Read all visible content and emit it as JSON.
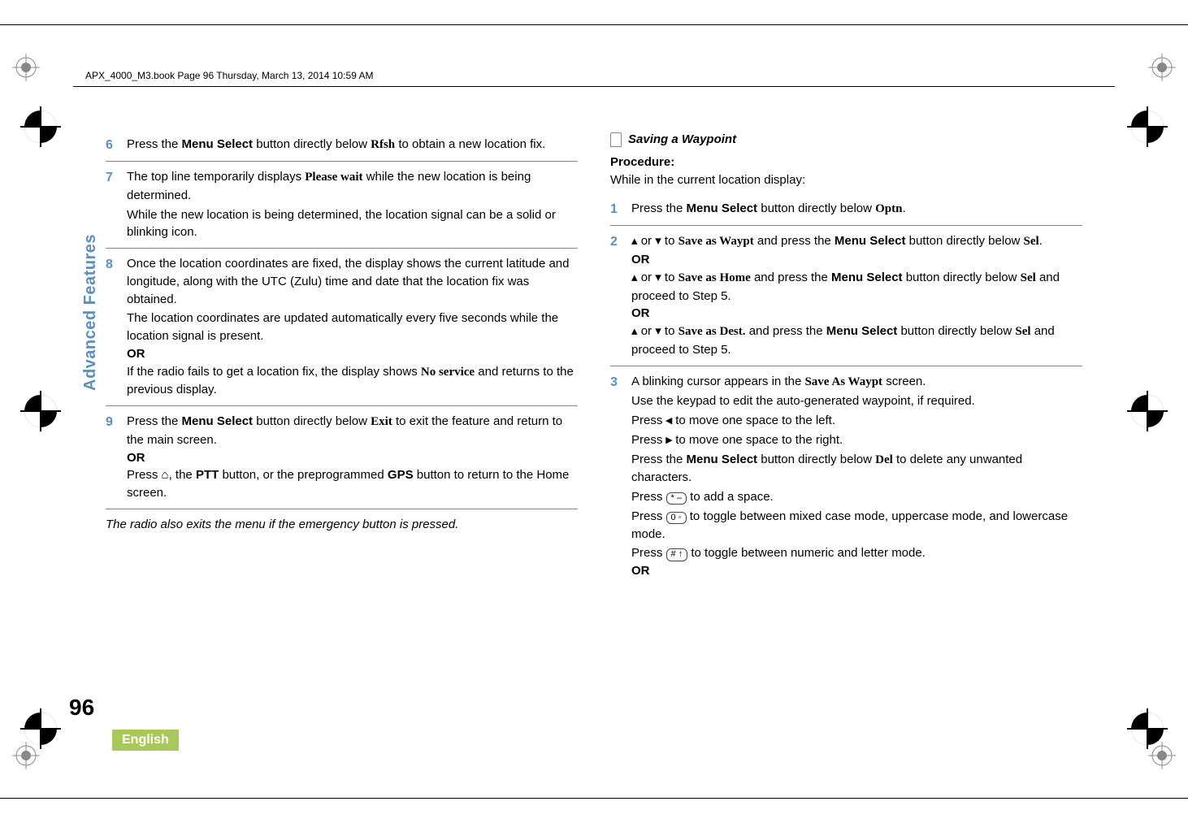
{
  "header": "APX_4000_M3.book  Page 96  Thursday, March 13, 2014  10:59 AM",
  "sidebar": "Advanced Features",
  "page_number": "96",
  "language": "English",
  "left": {
    "s6": {
      "num": "6",
      "text_a": "Press the ",
      "menu_select": "Menu Select",
      "text_b": " button directly below ",
      "rfsh": "Rfsh",
      "text_c": " to obtain a new location fix."
    },
    "s7": {
      "num": "7",
      "text_a": "The top line temporarily displays ",
      "please_wait": "Please wait",
      "text_b": " while the new location is being determined.",
      "text_c": "While the new location is being determined, the location signal can be a solid or blinking icon."
    },
    "s8": {
      "num": "8",
      "text_a": "Once the location coordinates are fixed, the display shows the current latitude and longitude, along with the UTC (Zulu) time and date that the location fix was obtained.",
      "text_b": "The location coordinates are updated automatically every five seconds while the location signal is present.",
      "or": "OR",
      "text_c": "If the radio fails to get a location fix, the display shows ",
      "no_service": "No service",
      "text_d": " and returns to the previous display."
    },
    "s9": {
      "num": "9",
      "text_a": "Press the ",
      "menu_select": "Menu Select",
      "text_b": " button directly below ",
      "exit": "Exit",
      "text_c": " to exit the feature and return to the main screen.",
      "or": "OR",
      "text_d": "Press ",
      "home": "⌂",
      "text_e": ", the ",
      "ptt": "PTT",
      "text_f": " button, or the preprogrammed ",
      "gps": "GPS",
      "text_g": " button to return to the Home screen."
    },
    "note": "The radio also exits the menu if the emergency button is pressed."
  },
  "right": {
    "section_title": "Saving a Waypoint",
    "procedure": "Procedure:",
    "procedure_desc": "While in the current location display:",
    "s1": {
      "num": "1",
      "text_a": "Press the ",
      "menu_select": "Menu Select",
      "text_b": " button directly below ",
      "optn": "Optn",
      "text_c": "."
    },
    "s2": {
      "num": "2",
      "up": "▴",
      "or_word": " or ",
      "down": "▾",
      "to": " to ",
      "save_waypt": "Save as Waypt",
      "text_a": " and press the ",
      "menu_select": "Menu Select",
      "text_b": " button directly below ",
      "sel": "Sel",
      "dot": ".",
      "or": "OR",
      "save_home": "Save as Home",
      "btn_txt": " and press the ",
      "menu_select2": "Menu Select",
      "btn_txt2": " button directly below ",
      "sel2": "Sel",
      "proceed": " and proceed to Step 5.",
      "save_dest": "Save as Dest.",
      "menu_select3": "Menu Select",
      "sel3": "Sel"
    },
    "s3": {
      "num": "3",
      "text_a": "A blinking cursor appears in the ",
      "save_as_waypt": "Save As Waypt",
      "text_b": " screen.",
      "text_c": "Use the keypad to edit the auto-generated waypoint, if required.",
      "press": "Press ",
      "left_ar": "◂",
      "left_txt": " to move one space to the left.",
      "right_ar": "▸",
      "right_txt": " to move one space to the right.",
      "text_d": "Press the ",
      "menu_select": "Menu Select",
      "text_e": " button directly below ",
      "del": "Del",
      "text_f": " to delete any unwanted characters.",
      "star_key": "* –",
      "star_txt": " to add a space.",
      "zero_key": "0 ◦",
      "zero_txt": " to toggle between mixed case mode, uppercase mode, and lowercase mode.",
      "hash_key": "# ↑",
      "hash_txt": " to toggle between numeric and letter mode.",
      "or": "OR"
    }
  }
}
